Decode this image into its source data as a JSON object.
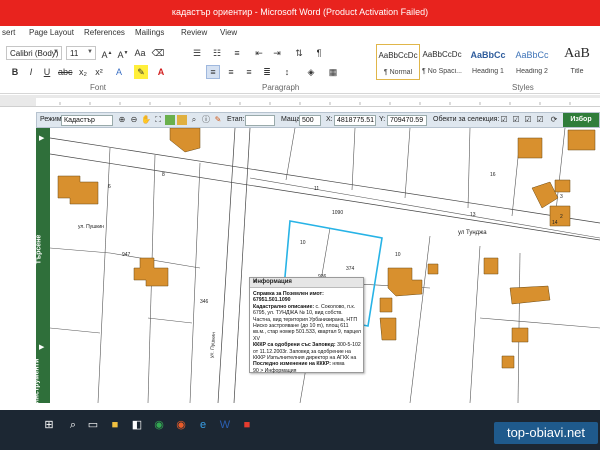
{
  "window": {
    "title": "кадастър ориентир - Microsoft Word (Product Activation Failed)"
  },
  "ribbon_tabs": [
    "sert",
    "Page Layout",
    "References",
    "Mailings",
    "Review",
    "View"
  ],
  "ribbon": {
    "font_name": "Calibri (Body)",
    "font_size": "11",
    "font_group_label": "Font",
    "paragraph_group_label": "Paragraph",
    "styles_group_label": "Styles",
    "styles": [
      {
        "sample": "AaBbCcDc",
        "name": "¶ Normal",
        "selected": true
      },
      {
        "sample": "AaBbCcDc",
        "name": "¶ No Spaci...",
        "selected": false
      },
      {
        "sample": "AaBbCc",
        "name": "Heading 1",
        "selected": false
      },
      {
        "sample": "AaBbCc",
        "name": "Heading 2",
        "selected": false
      },
      {
        "sample": "AaB",
        "name": "Title",
        "selected": false
      }
    ]
  },
  "map_toolbar": {
    "mode_label": "Режим:",
    "mode_value": "Кадастър",
    "stage_label": "Етап:",
    "scale_label": "Мащаб 1:",
    "scale_value": "500",
    "x_label": "X:",
    "x_value": "4818775.51",
    "y_label": "Y:",
    "y_value": "709470.59",
    "selection_label": "Обекти за селекция:",
    "choose_label": "Избор"
  },
  "sidebar": {
    "search_label": "Търсене",
    "tools_label": "Инструменти"
  },
  "map": {
    "labels": [
      "6",
      "8",
      "9",
      "11",
      "10",
      "13",
      "14",
      "15",
      "16",
      "1",
      "2",
      "3",
      "4",
      "5",
      "10",
      "11",
      "12",
      "15",
      "16",
      "17",
      "ул Тунджа",
      "ул. Пушкин",
      "ул. Пушкин",
      "947",
      "346",
      "939",
      "362",
      "374",
      "1090",
      "936",
      "3",
      "2"
    ],
    "highlight_label": "10"
  },
  "popup": {
    "title": "Информация",
    "close": "×",
    "heading": "Справка за Поземлен имот: 67951.501.1090",
    "desc_label": "Кадастрално описание:",
    "desc_text": "с. Соколово, п.к. 6795, ул. ТУНДЖА № 10, вид собств. Частна, вид територия Урбанизирана, НТП Ниско застрояване (до 10 m), площ 611 кв.м., стар номер 501.533, квартал 9, парцел XV",
    "order_label": "КККР са одобрени със Заповед:",
    "order_text": "300-5-102 от 11.12.2003г. Заповед за одобрение на КККР Изпълнителния директор на АГКК на",
    "last_change_label": "Последно изменение на КККР:",
    "last_change_text": "няма",
    "footer": "90 > Информация"
  },
  "watermark": "top-obiavi.net"
}
